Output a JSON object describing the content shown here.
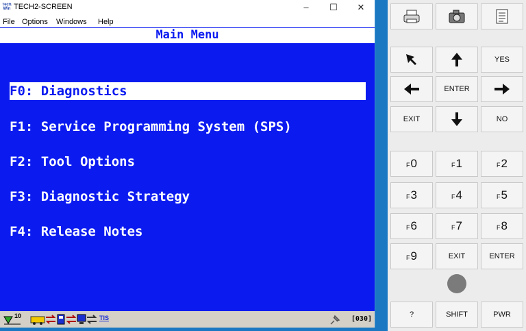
{
  "window": {
    "icon_text": "Tech2 Win",
    "title": "TECH2-SCREEN",
    "minimize": "–",
    "maximize": "☐",
    "close": "✕"
  },
  "menubar": [
    "File",
    "Options",
    "Windows",
    "Help"
  ],
  "screen": {
    "title": "Main Menu",
    "items": [
      "F0: Diagnostics",
      "F1: Service Programming System (SPS)",
      "F2: Tool Options",
      "F3: Diagnostic Strategy",
      "F4: Release Notes"
    ],
    "selected_index": 0
  },
  "statusbar": {
    "signal_number": "10",
    "tis_label": "TIS",
    "code": "[030]"
  },
  "keypad": {
    "yes": "YES",
    "enter": "ENTER",
    "exit": "EXIT",
    "no": "NO",
    "fkey_prefix": "F",
    "fkeys": [
      "0",
      "1",
      "2",
      "3",
      "4",
      "5",
      "6",
      "7",
      "8",
      "9"
    ],
    "exit2": "EXIT",
    "enter2": "ENTER",
    "help": "?",
    "shift": "SHIFT",
    "pwr": "PWR"
  },
  "icons": {
    "print": "printer-icon",
    "camera": "camera-icon",
    "document": "document-icon",
    "pointer": "pointer-arrow-icon",
    "up": "arrow-up-icon",
    "left": "arrow-left-icon",
    "right": "arrow-right-icon",
    "down": "arrow-down-icon"
  },
  "colors": {
    "screen_blue": "#0b1bf0",
    "desktop_blue": "#1a78c2",
    "power_led": "#7b7b7b"
  }
}
